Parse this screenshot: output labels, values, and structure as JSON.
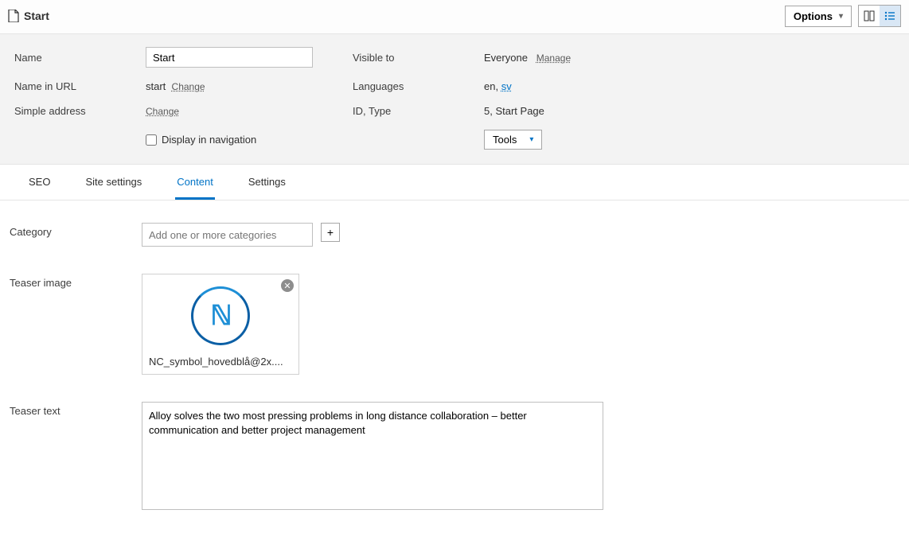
{
  "header": {
    "title": "Start",
    "options_label": "Options"
  },
  "meta": {
    "name_label": "Name",
    "name_value": "Start",
    "url_label": "Name in URL",
    "url_value": "start",
    "change_label": "Change",
    "simple_addr_label": "Simple address",
    "display_nav_label": "Display in navigation",
    "visible_label": "Visible to",
    "visible_value": "Everyone",
    "manage_label": "Manage",
    "languages_label": "Languages",
    "lang_primary": "en",
    "lang_secondary": "sv",
    "idtype_label": "ID, Type",
    "idtype_value": "5, Start Page",
    "tools_label": "Tools"
  },
  "tabs": [
    "SEO",
    "Site settings",
    "Content",
    "Settings"
  ],
  "active_tab": 2,
  "content": {
    "category_label": "Category",
    "category_placeholder": "Add one or more categories",
    "teaser_image_label": "Teaser image",
    "teaser_image_name": "NC_symbol_hovedblå@2x....",
    "teaser_text_label": "Teaser text",
    "teaser_text_value": "Alloy solves the two most pressing problems in long distance collaboration – better communication and better project management"
  }
}
